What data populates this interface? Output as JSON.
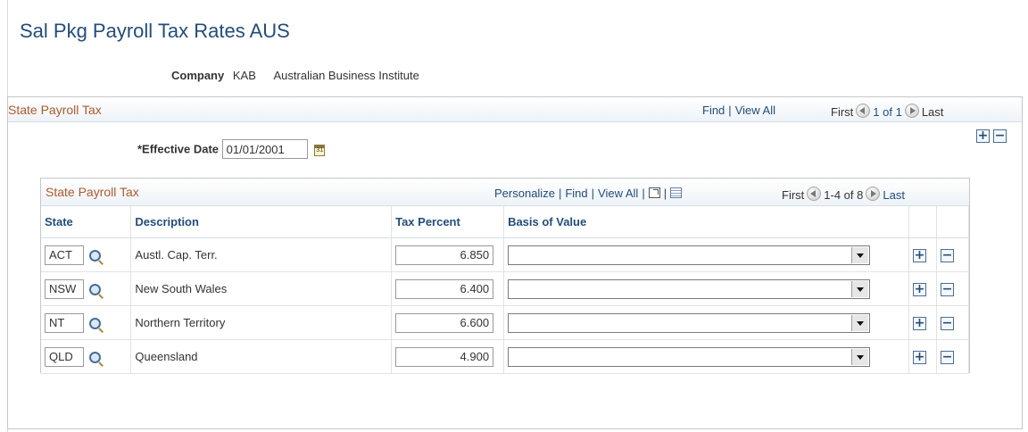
{
  "page": {
    "title": "Sal Pkg Payroll Tax Rates AUS",
    "company_label": "Company",
    "company_code": "KAB",
    "company_name": "Australian Business Institute"
  },
  "outer_grid": {
    "title": "State Payroll Tax",
    "find": "Find",
    "view_all": "View All",
    "first": "First",
    "range": "1 of 1",
    "last": "Last"
  },
  "effective_date": {
    "label": "*Effective Date",
    "value": "01/01/2001"
  },
  "inner_grid": {
    "title": "State Payroll Tax",
    "personalize": "Personalize",
    "find": "Find",
    "view_all": "View All",
    "first": "First",
    "range": "1-4 of 8",
    "last": "Last",
    "columns": [
      "State",
      "Description",
      "Tax Percent",
      "Basis of Value"
    ],
    "rows": [
      {
        "state": "ACT",
        "description": "Austl. Cap. Terr.",
        "tax_percent": "6.850",
        "basis": ""
      },
      {
        "state": "NSW",
        "description": "New South Wales",
        "tax_percent": "6.400",
        "basis": ""
      },
      {
        "state": "NT",
        "description": "Northern Territory",
        "tax_percent": "6.600",
        "basis": ""
      },
      {
        "state": "QLD",
        "description": "Queensland",
        "tax_percent": "4.900",
        "basis": ""
      }
    ]
  },
  "buttons": {
    "add": "+",
    "delete": "−"
  },
  "colors": {
    "title": "#234d7a",
    "section_title": "#b05a2a",
    "link": "#234d7a"
  }
}
